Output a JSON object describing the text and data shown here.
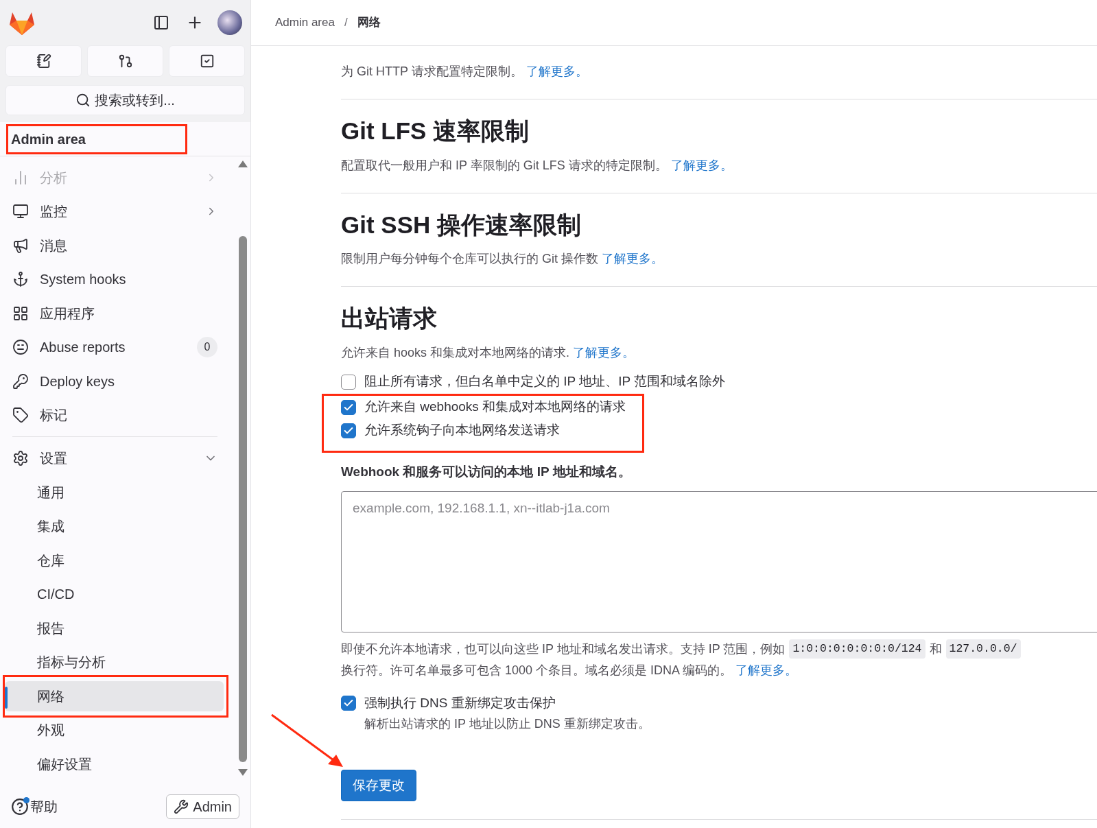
{
  "sidebar": {
    "search_button": "搜索或转到...",
    "section_title": {
      "text": "Admin area",
      "highlighted": true
    },
    "items": [
      {
        "label": "分析",
        "chevron": true,
        "faded": true
      },
      {
        "label": "监控",
        "chevron": true,
        "faded": false
      },
      {
        "label": "消息",
        "chevron": false,
        "faded": false
      },
      {
        "label": "System hooks",
        "chevron": false,
        "faded": false
      },
      {
        "label": "应用程序",
        "chevron": false,
        "faded": false
      },
      {
        "label": "Abuse reports",
        "chevron": false,
        "faded": false,
        "count": "0"
      },
      {
        "label": "Deploy keys",
        "chevron": false,
        "faded": false
      },
      {
        "label": "标记",
        "chevron": false,
        "faded": false
      }
    ],
    "settings": {
      "label": "设置",
      "expanded": true,
      "children": [
        {
          "label": "通用",
          "selected": false,
          "highlighted": false
        },
        {
          "label": "集成",
          "selected": false,
          "highlighted": false
        },
        {
          "label": "仓库",
          "selected": false,
          "highlighted": false
        },
        {
          "label": "CI/CD",
          "selected": false,
          "highlighted": false
        },
        {
          "label": "报告",
          "selected": false,
          "highlighted": false
        },
        {
          "label": "指标与分析",
          "selected": false,
          "highlighted": false
        },
        {
          "label": "网络",
          "selected": true,
          "highlighted": true
        },
        {
          "label": "外观",
          "selected": false,
          "highlighted": false
        },
        {
          "label": "偏好设置",
          "selected": false,
          "highlighted": false
        }
      ]
    },
    "help": {
      "label": "帮助",
      "notification": true
    },
    "admin_button": "Admin"
  },
  "breadcrumb": [
    "Admin area",
    "网络"
  ],
  "breadcrumb_separator": "/",
  "sections": [
    {
      "description": "为 Git HTTP 请求配置特定限制。",
      "link": "了解更多。"
    },
    {
      "title": "Git LFS 速率限制",
      "description": "配置取代一般用户和 IP 率限制的 Git LFS 请求的特定限制。",
      "link": "了解更多。"
    },
    {
      "title": "Git SSH 操作速率限制",
      "description": "限制用户每分钟每个仓库可以执行的 Git 操作数",
      "link": "了解更多。"
    }
  ],
  "outbound": {
    "title": "出站请求",
    "description": "允许来自 hooks 和集成对本地网络的请求.",
    "link": "了解更多。",
    "checkboxes": [
      {
        "label": "阻止所有请求，但白名单中定义的 IP 地址、IP 范围和域名除外",
        "checked": false,
        "highlighted": false
      },
      {
        "label": "允许来自 webhooks 和集成对本地网络的请求",
        "checked": true,
        "highlighted": true
      },
      {
        "label": "允许系统钩子向本地网络发送请求",
        "checked": true,
        "highlighted": true
      }
    ],
    "field_label": "Webhook 和服务可以访问的本地 IP 地址和域名。",
    "placeholder": "example.com, 192.168.1.1, xn--itlab-j1a.com",
    "help_line_1": [
      {
        "kind": "text",
        "text": "即使不允许本地请求，也可以向这些 IP 地址和域名发出请求。支持 IP 范围，例如"
      },
      {
        "kind": "code",
        "text": "1:0:0:0:0:0:0:0/124"
      },
      {
        "kind": "text",
        "text": "和"
      },
      {
        "kind": "code",
        "text": "127.0.0.0/"
      }
    ],
    "help_line_2": "换行符。许可名单最多可包含 1000 个条目。域名必须是 IDNA 编码的。",
    "help_link": "了解更多。",
    "dns": {
      "label": "强制执行 DNS 重新绑定攻击保护",
      "description": "解析出站请求的 IP 地址以防止 DNS 重新绑定攻击。",
      "checked": true
    },
    "save_button": {
      "label": "保存更改",
      "arrow": true
    }
  }
}
